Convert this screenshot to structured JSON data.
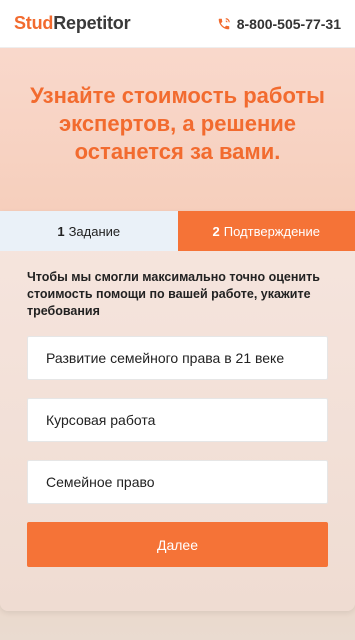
{
  "header": {
    "logo_part1": "Stud",
    "logo_part2": "Repetitor",
    "phone": "8-800-505-77-31"
  },
  "hero": {
    "title": "Узнайте стоимость работы экспертов, а решение останется за вами."
  },
  "tabs": [
    {
      "num": "1",
      "label": "Задание"
    },
    {
      "num": "2",
      "label": "Подтверждение"
    }
  ],
  "form": {
    "instruction": "Чтобы мы смогли максимально точно оценить стоимость помощи по вашей работе, укажите требования",
    "topic": "Развитие семейного права в 21 веке",
    "work_type": "Курсовая работа",
    "subject": "Семейное право",
    "next_label": "Далее"
  },
  "colors": {
    "accent": "#f57337",
    "title": "#f26b2f"
  },
  "icons": {
    "phone": "phone-icon"
  }
}
